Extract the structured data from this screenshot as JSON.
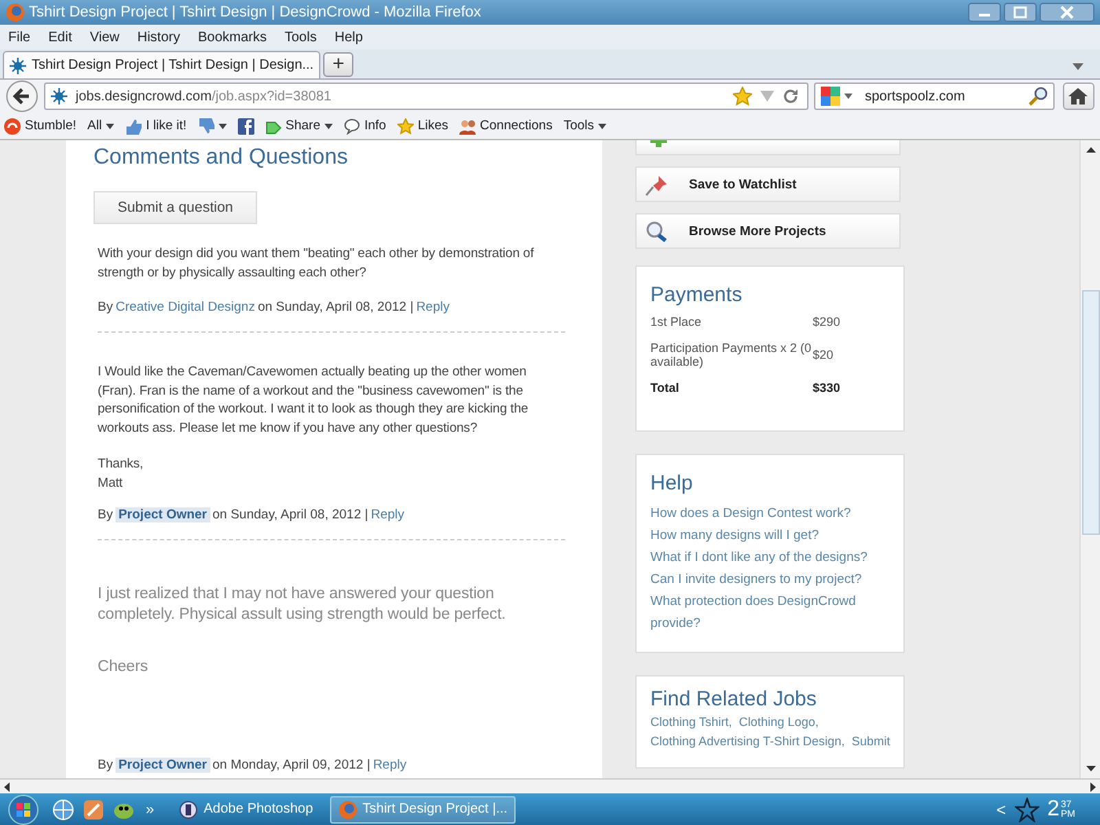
{
  "window": {
    "title": "Tshirt Design Project | Tshirt Design | DesignCrowd - Mozilla Firefox"
  },
  "menu": [
    "File",
    "Edit",
    "View",
    "History",
    "Bookmarks",
    "Tools",
    "Help"
  ],
  "tabs": [
    {
      "label": "Tshirt Design Project | Tshirt Design | Design...",
      "selected": true
    }
  ],
  "new_tab": "+",
  "address": {
    "host": "jobs.designcrowd.com",
    "path": "/job.aspx?id=38081"
  },
  "search": {
    "value": "sportspoolz.com"
  },
  "bookmarks": [
    {
      "label": "Stumble!",
      "dropdown": false
    },
    {
      "label": "All",
      "dropdown": true
    },
    {
      "label": "I like it!",
      "dropdown": false
    },
    {
      "dropdown": true
    },
    {
      "dropdown": false
    },
    {
      "label": "Share",
      "dropdown": true
    },
    {
      "label": "Info",
      "dropdown": false
    },
    {
      "label": "Likes",
      "dropdown": false
    },
    {
      "label": "Connections",
      "dropdown": false
    },
    {
      "label": "Tools",
      "dropdown": true
    }
  ],
  "comments_section": {
    "title": "Comments and Questions",
    "submit_button": "Submit a question",
    "comments": [
      {
        "kind": "normal",
        "paragraphs": [
          "With your design did you want them \"beating\" each other by demonstration of strength or by physically assaulting each other?"
        ],
        "by": "By",
        "author": "Creative Digital Designz",
        "author_is_owner": false,
        "date": "on Sunday, April 08, 2012 |",
        "reply": "Reply"
      },
      {
        "kind": "normal",
        "paragraphs": [
          "I Would like the Caveman/Cavewomen actually beating up the other women (Fran). Fran is the name of a workout and the \"business cavewomen\" is the personification of the workout. I want it to look as though they are kicking the workouts ass. Please let me know if you have any other questions?",
          "Thanks,\nMatt"
        ],
        "by": "By",
        "author": "Project Owner",
        "author_is_owner": true,
        "date": "on Sunday, April 08, 2012 |",
        "reply": "Reply"
      },
      {
        "kind": "large",
        "paragraphs": [
          "I just realized that I may not have answered your question completely. Physical assult using strength would be perfect.",
          "Cheers"
        ],
        "by": "By",
        "author": "Project Owner",
        "author_is_owner": true,
        "date": "on Monday, April 09, 2012 |",
        "reply": "Reply"
      }
    ]
  },
  "actions": [
    {
      "label": "Save to Watchlist"
    },
    {
      "label": "Browse More Projects"
    }
  ],
  "payments": {
    "title": "Payments",
    "rows": [
      {
        "kind": "item",
        "label": "1st Place",
        "amount": "$290"
      },
      {
        "kind": "item",
        "label": "Participation Payments x 2 (0 available)",
        "amount": "$20"
      },
      {
        "kind": "total",
        "label": "Total",
        "amount": "$330"
      }
    ]
  },
  "help": {
    "title": "Help",
    "links": [
      "How does a Design Contest work?",
      "How many designs will I get?",
      "What if I dont like any of the designs?",
      "Can I invite designers to my project?",
      "What protection does DesignCrowd provide?"
    ]
  },
  "related_jobs": {
    "title": "Find Related Jobs",
    "links": [
      "Clothing Tshirt,",
      "Clothing Logo,",
      "Clothing Advertising T-Shirt Design,",
      "Submit"
    ]
  },
  "taskbar": {
    "overflow": "»",
    "items": [
      {
        "label": "Adobe Photoshop",
        "selected": false
      },
      {
        "label": "Tshirt Design Project |...",
        "selected": true
      }
    ],
    "tray_toggle": "<",
    "clock": {
      "hour": "2",
      "minute": "37",
      "period": "PM"
    }
  }
}
